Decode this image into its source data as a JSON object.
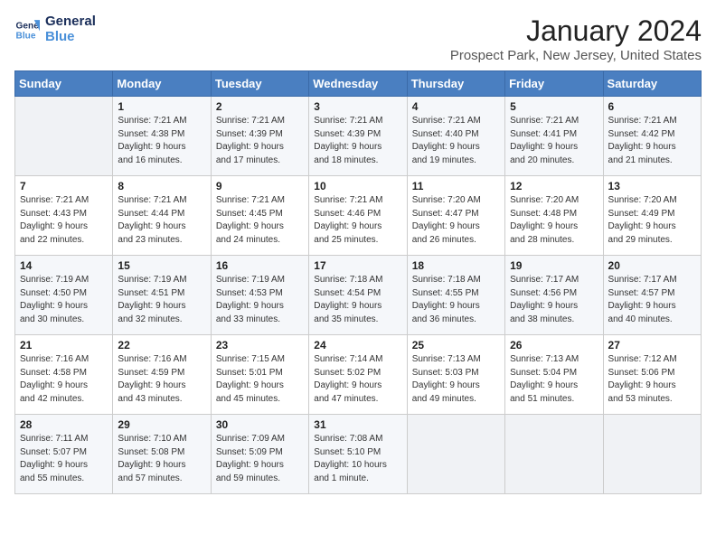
{
  "header": {
    "logo_line1": "General",
    "logo_line2": "Blue",
    "month": "January 2024",
    "location": "Prospect Park, New Jersey, United States"
  },
  "weekdays": [
    "Sunday",
    "Monday",
    "Tuesday",
    "Wednesday",
    "Thursday",
    "Friday",
    "Saturday"
  ],
  "weeks": [
    [
      {
        "day": "",
        "info": ""
      },
      {
        "day": "1",
        "info": "Sunrise: 7:21 AM\nSunset: 4:38 PM\nDaylight: 9 hours\nand 16 minutes."
      },
      {
        "day": "2",
        "info": "Sunrise: 7:21 AM\nSunset: 4:39 PM\nDaylight: 9 hours\nand 17 minutes."
      },
      {
        "day": "3",
        "info": "Sunrise: 7:21 AM\nSunset: 4:39 PM\nDaylight: 9 hours\nand 18 minutes."
      },
      {
        "day": "4",
        "info": "Sunrise: 7:21 AM\nSunset: 4:40 PM\nDaylight: 9 hours\nand 19 minutes."
      },
      {
        "day": "5",
        "info": "Sunrise: 7:21 AM\nSunset: 4:41 PM\nDaylight: 9 hours\nand 20 minutes."
      },
      {
        "day": "6",
        "info": "Sunrise: 7:21 AM\nSunset: 4:42 PM\nDaylight: 9 hours\nand 21 minutes."
      }
    ],
    [
      {
        "day": "7",
        "info": "Sunrise: 7:21 AM\nSunset: 4:43 PM\nDaylight: 9 hours\nand 22 minutes."
      },
      {
        "day": "8",
        "info": "Sunrise: 7:21 AM\nSunset: 4:44 PM\nDaylight: 9 hours\nand 23 minutes."
      },
      {
        "day": "9",
        "info": "Sunrise: 7:21 AM\nSunset: 4:45 PM\nDaylight: 9 hours\nand 24 minutes."
      },
      {
        "day": "10",
        "info": "Sunrise: 7:21 AM\nSunset: 4:46 PM\nDaylight: 9 hours\nand 25 minutes."
      },
      {
        "day": "11",
        "info": "Sunrise: 7:20 AM\nSunset: 4:47 PM\nDaylight: 9 hours\nand 26 minutes."
      },
      {
        "day": "12",
        "info": "Sunrise: 7:20 AM\nSunset: 4:48 PM\nDaylight: 9 hours\nand 28 minutes."
      },
      {
        "day": "13",
        "info": "Sunrise: 7:20 AM\nSunset: 4:49 PM\nDaylight: 9 hours\nand 29 minutes."
      }
    ],
    [
      {
        "day": "14",
        "info": "Sunrise: 7:19 AM\nSunset: 4:50 PM\nDaylight: 9 hours\nand 30 minutes."
      },
      {
        "day": "15",
        "info": "Sunrise: 7:19 AM\nSunset: 4:51 PM\nDaylight: 9 hours\nand 32 minutes."
      },
      {
        "day": "16",
        "info": "Sunrise: 7:19 AM\nSunset: 4:53 PM\nDaylight: 9 hours\nand 33 minutes."
      },
      {
        "day": "17",
        "info": "Sunrise: 7:18 AM\nSunset: 4:54 PM\nDaylight: 9 hours\nand 35 minutes."
      },
      {
        "day": "18",
        "info": "Sunrise: 7:18 AM\nSunset: 4:55 PM\nDaylight: 9 hours\nand 36 minutes."
      },
      {
        "day": "19",
        "info": "Sunrise: 7:17 AM\nSunset: 4:56 PM\nDaylight: 9 hours\nand 38 minutes."
      },
      {
        "day": "20",
        "info": "Sunrise: 7:17 AM\nSunset: 4:57 PM\nDaylight: 9 hours\nand 40 minutes."
      }
    ],
    [
      {
        "day": "21",
        "info": "Sunrise: 7:16 AM\nSunset: 4:58 PM\nDaylight: 9 hours\nand 42 minutes."
      },
      {
        "day": "22",
        "info": "Sunrise: 7:16 AM\nSunset: 4:59 PM\nDaylight: 9 hours\nand 43 minutes."
      },
      {
        "day": "23",
        "info": "Sunrise: 7:15 AM\nSunset: 5:01 PM\nDaylight: 9 hours\nand 45 minutes."
      },
      {
        "day": "24",
        "info": "Sunrise: 7:14 AM\nSunset: 5:02 PM\nDaylight: 9 hours\nand 47 minutes."
      },
      {
        "day": "25",
        "info": "Sunrise: 7:13 AM\nSunset: 5:03 PM\nDaylight: 9 hours\nand 49 minutes."
      },
      {
        "day": "26",
        "info": "Sunrise: 7:13 AM\nSunset: 5:04 PM\nDaylight: 9 hours\nand 51 minutes."
      },
      {
        "day": "27",
        "info": "Sunrise: 7:12 AM\nSunset: 5:06 PM\nDaylight: 9 hours\nand 53 minutes."
      }
    ],
    [
      {
        "day": "28",
        "info": "Sunrise: 7:11 AM\nSunset: 5:07 PM\nDaylight: 9 hours\nand 55 minutes."
      },
      {
        "day": "29",
        "info": "Sunrise: 7:10 AM\nSunset: 5:08 PM\nDaylight: 9 hours\nand 57 minutes."
      },
      {
        "day": "30",
        "info": "Sunrise: 7:09 AM\nSunset: 5:09 PM\nDaylight: 9 hours\nand 59 minutes."
      },
      {
        "day": "31",
        "info": "Sunrise: 7:08 AM\nSunset: 5:10 PM\nDaylight: 10 hours\nand 1 minute."
      },
      {
        "day": "",
        "info": ""
      },
      {
        "day": "",
        "info": ""
      },
      {
        "day": "",
        "info": ""
      }
    ]
  ]
}
